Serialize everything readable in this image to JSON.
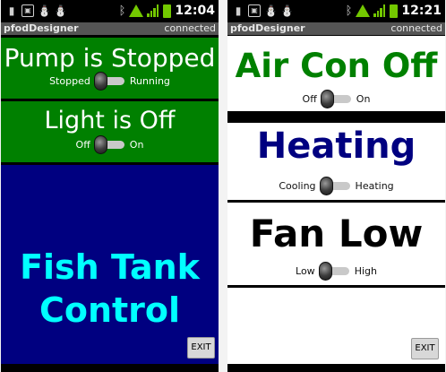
{
  "left": {
    "status_bar": {
      "time": "12:04"
    },
    "title_bar": {
      "app_name": "pfodDesigner",
      "status": "connected"
    },
    "panels": [
      {
        "title": "Pump is Stopped",
        "off_label": "Stopped",
        "on_label": "Running",
        "bg": "#008000"
      },
      {
        "title": "Light is Off",
        "off_label": "Off",
        "on_label": "On",
        "bg": "#008000"
      }
    ],
    "fish": {
      "line1": "Fish Tank",
      "line2": "Control",
      "bg": "#000080",
      "color": "#00ffff"
    },
    "exit_label": "EXIT"
  },
  "right": {
    "status_bar": {
      "time": "12:21"
    },
    "title_bar": {
      "app_name": "pfodDesigner",
      "status": "connected"
    },
    "panels": [
      {
        "title": "Air Con Off",
        "off_label": "Off",
        "on_label": "On",
        "color": "#008000"
      },
      {
        "title": "Heating",
        "off_label": "Cooling",
        "on_label": "Heating",
        "color": "#000080"
      },
      {
        "title": "Fan Low",
        "off_label": "Low",
        "on_label": "High",
        "color": "#000000"
      }
    ],
    "exit_label": "EXIT"
  },
  "icons": {
    "status_left": [
      "sd-card-icon",
      "image-icon",
      "android-icon",
      "android-icon"
    ],
    "status_right": [
      "bluetooth-icon",
      "wifi-icon",
      "signal-icon",
      "battery-icon"
    ]
  }
}
